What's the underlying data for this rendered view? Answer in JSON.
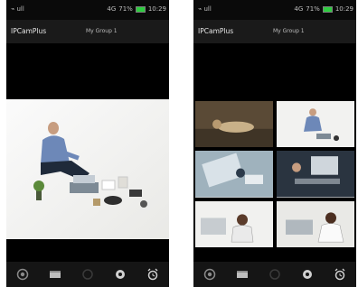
{
  "status_bar": {
    "left_phone": {
      "signal_text": "⌁ ull",
      "network": "4G",
      "battery_pct": "71%",
      "time": "10:29"
    },
    "right_phone": {
      "signal_text": "⌁ ull",
      "network": "4G",
      "battery_pct": "71%",
      "time": "10:29"
    }
  },
  "header": {
    "app_title": "IPCamPlus",
    "group_label": "My Group 1"
  },
  "bottom_nav": {
    "items": [
      {
        "icon": "camera-icon"
      },
      {
        "icon": "film-icon"
      },
      {
        "icon": "record-icon"
      },
      {
        "icon": "settings-icon"
      },
      {
        "icon": "alarm-clock-icon"
      }
    ]
  },
  "views": {
    "left": {
      "mode": "single"
    },
    "right": {
      "mode": "grid",
      "feed_count": 6
    }
  },
  "colors": {
    "background": "#000000",
    "status_bar": "#0a0a0a",
    "title_bar": "#1a1a1a",
    "bottom_bar": "#151515",
    "battery": "#2ecc40",
    "text": "#d8d8d8"
  }
}
